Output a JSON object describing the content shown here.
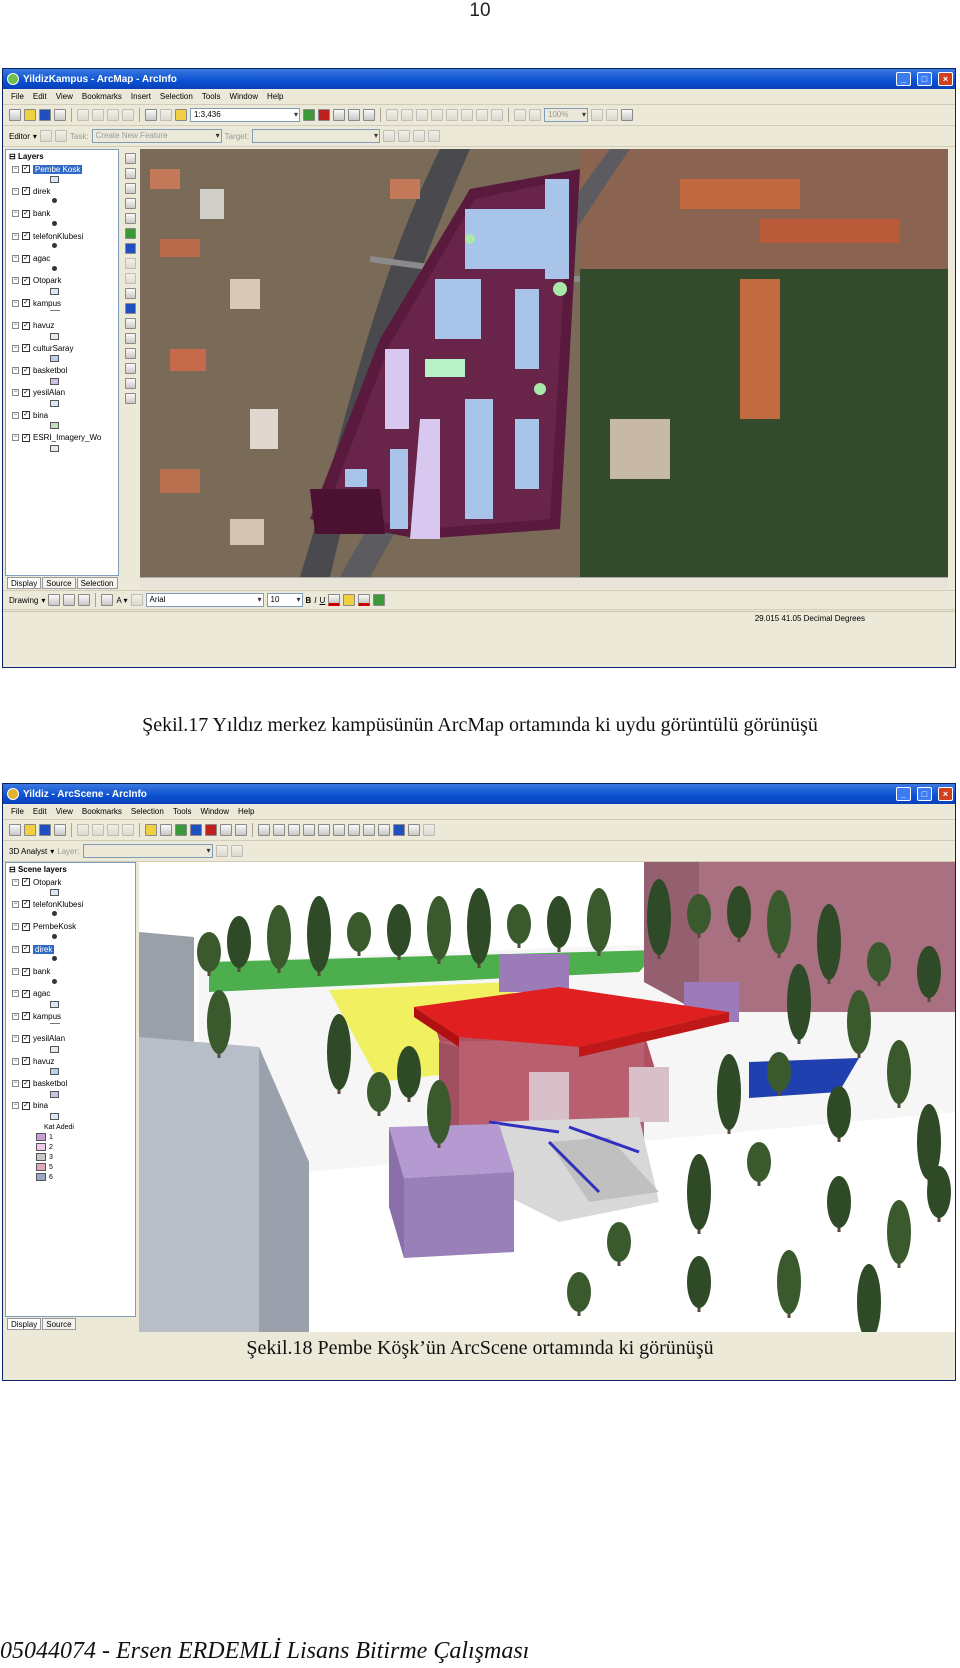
{
  "page_number": "10",
  "figure1": {
    "window_title": "YildizKampus - ArcMap - ArcInfo",
    "menu": [
      "File",
      "Edit",
      "View",
      "Bookmarks",
      "Insert",
      "Selection",
      "Tools",
      "Window",
      "Help"
    ],
    "scale": "1:3,436",
    "zoom_percent": "100%",
    "editor_label": "Editor",
    "task_label": "Task:",
    "task_value": "Create New Feature",
    "target_label": "Target:",
    "toc_title": "Layers",
    "layers": [
      {
        "name": "Pembe Kosk",
        "selected": true
      },
      {
        "name": "direk"
      },
      {
        "name": "bank"
      },
      {
        "name": "telefonKlubesi"
      },
      {
        "name": "agac"
      },
      {
        "name": "Otopark"
      },
      {
        "name": "kampus"
      },
      {
        "name": "havuz"
      },
      {
        "name": "culturSaray"
      },
      {
        "name": "basketbol"
      },
      {
        "name": "yesilAlan"
      },
      {
        "name": "bina"
      },
      {
        "name": "ESRI_Imagery_Wo"
      }
    ],
    "tabs": [
      "Display",
      "Source",
      "Selection"
    ],
    "drawing_label": "Drawing",
    "font_name": "Arial",
    "font_size": "10",
    "coordinates": "29.015  41.05 Decimal Degrees",
    "caption": "Şekil.17 Yıldız merkez kampüsünün ArcMap ortamında ki uydu görüntülü görünüşü"
  },
  "figure2": {
    "window_title": "Yildiz - ArcScene - ArcInfo",
    "menu": [
      "File",
      "Edit",
      "View",
      "Bookmarks",
      "Selection",
      "Tools",
      "Window",
      "Help"
    ],
    "analyst_label": "3D Analyst",
    "layer_label": "Layer:",
    "toc_title": "Scene layers",
    "layers": [
      {
        "name": "Otopark"
      },
      {
        "name": "telefonKlubesi"
      },
      {
        "name": "PembeKosk"
      },
      {
        "name": "direk",
        "selected": true
      },
      {
        "name": "bank"
      },
      {
        "name": "agac"
      },
      {
        "name": "kampus"
      },
      {
        "name": "yesilAlan"
      },
      {
        "name": "havuz"
      },
      {
        "name": "basketbol"
      },
      {
        "name": "bina"
      }
    ],
    "legend_field": "Kat Adedi",
    "legend_classes": [
      "1",
      "2",
      "3",
      "5",
      "6"
    ],
    "tabs": [
      "Display",
      "Source"
    ],
    "caption": "Şekil.18 Pembe Köşk’ün ArcScene ortamında ki görünüşü"
  },
  "footer": "05044074 - Ersen ERDEMLİ Lisans Bitirme Çalışması"
}
